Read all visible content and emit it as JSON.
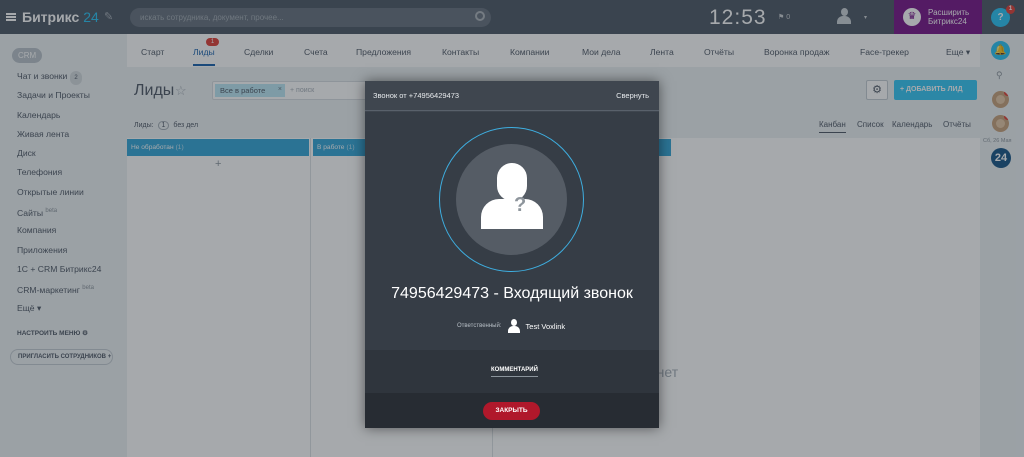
{
  "app": {
    "name": "Битрикс",
    "name_num": "24"
  },
  "search": {
    "placeholder": "искать сотрудника, документ, прочее..."
  },
  "header": {
    "time": "12:53",
    "flag_text": "⚑ 0",
    "upgrade_line1": "Расширить",
    "upgrade_line2": "Битрикс24",
    "help_badge": "1"
  },
  "sidebar": {
    "crm_label": "CRM",
    "items": [
      {
        "label": "Чат и звонки",
        "count": "2"
      },
      {
        "label": "Задачи и Проекты"
      },
      {
        "label": "Календарь"
      },
      {
        "label": "Живая лента"
      },
      {
        "label": "Диск"
      },
      {
        "label": "Телефония"
      },
      {
        "label": "Открытые линии"
      },
      {
        "label": "Сайты",
        "sup": "beta"
      },
      {
        "label": "Компания"
      },
      {
        "label": "Приложения"
      },
      {
        "label": "1С + CRM Битрикс24"
      },
      {
        "label": "CRM-маркетинг",
        "sup": "beta"
      },
      {
        "label": "Ещё ▾"
      }
    ],
    "settings_label": "НАСТРОИТЬ МЕНЮ",
    "invite_label": "ПРИГЛАСИТЬ СОТРУДНИКОВ"
  },
  "tabs": [
    {
      "label": "Старт"
    },
    {
      "label": "Лиды",
      "badge": "1"
    },
    {
      "label": "Сделки"
    },
    {
      "label": "Счета"
    },
    {
      "label": "Предложения"
    },
    {
      "label": "Контакты"
    },
    {
      "label": "Компании"
    },
    {
      "label": "Мои дела"
    },
    {
      "label": "Лента"
    },
    {
      "label": "Отчёты"
    },
    {
      "label": "Воронка продаж"
    },
    {
      "label": "Face-трекер"
    },
    {
      "label": "Еще ▾"
    }
  ],
  "page": {
    "title": "Лиды",
    "filter_tag": "Все в работе",
    "filter_placeholder": "+ поиск",
    "add_label": "+ ДОБАВИТЬ ЛИД",
    "leads_prefix": "Лиды:",
    "leads_count": "1",
    "leads_suffix": "без дел",
    "views": [
      "Канбан",
      "Список",
      "Календарь",
      "Отчёты"
    ],
    "columns": [
      {
        "title": "Не обработан",
        "count": "(1)"
      },
      {
        "title": "В работе",
        "count": "(1)"
      },
      {
        "title": "",
        "count": ""
      }
    ],
    "empty_text": "е нет"
  },
  "rightbar": {
    "date": "Сб, 26 Мая",
    "logo": "24"
  },
  "dialog": {
    "title": "Звонок от +74956429473",
    "minimize": "Свернуть",
    "caller": "74956429473 - Входящий звонок",
    "responsible_label": "Ответственный:",
    "responsible_name": "Test Voxlink",
    "comment_label": "КОММЕНТАРИЙ",
    "close_label": "ЗАКРЫТЬ"
  },
  "colors": {
    "accent": "#2fc6f6",
    "topbar": "#525c69",
    "upgrade": "#7b1a8c",
    "kanban_header": "#39a8d8",
    "close_button": "#b0182b"
  }
}
